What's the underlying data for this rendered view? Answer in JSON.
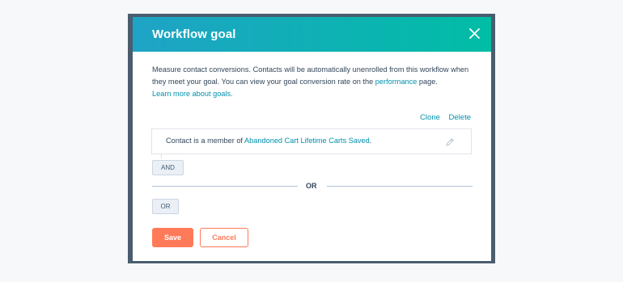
{
  "modal": {
    "title": "Workflow goal",
    "close_icon": "close-icon"
  },
  "description": {
    "text_before_link": "Measure contact conversions. Contacts will be automatically unenrolled from this workflow when they meet your goal. You can view your goal conversion rate on the ",
    "performance_link": "performance",
    "text_after_link": " page.",
    "learn_more_link": "Learn more about goals."
  },
  "goal_actions": {
    "clone_label": "Clone",
    "delete_label": "Delete"
  },
  "filter": {
    "prefix": "Contact is a member of ",
    "list_link": "Abandoned Cart Lifetime Carts Saved",
    "suffix": ".",
    "edit_icon": "pencil-icon"
  },
  "and_button_label": "AND",
  "or_divider_label": "OR",
  "or_button_label": "OR",
  "footer": {
    "save_label": "Save",
    "cancel_label": "Cancel"
  },
  "colors": {
    "header_gradient_start": "#1fa3c6",
    "header_gradient_end": "#00bda5",
    "link": "#0091ae",
    "primary_button": "#ff7a59",
    "text": "#33475b"
  }
}
